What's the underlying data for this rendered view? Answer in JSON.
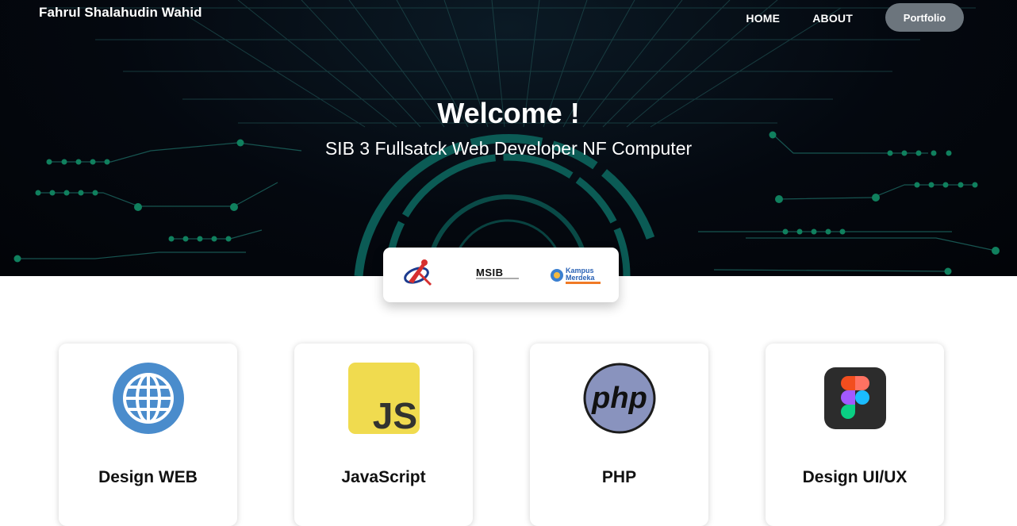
{
  "header": {
    "brand": "Fahrul Shalahudin Wahid",
    "nav": {
      "home": "HOME",
      "about": "ABOUT",
      "portfolio": "Portfolio"
    }
  },
  "hero": {
    "title": "Welcome !",
    "subtitle": "SIB 3 Fullsatck Web Developer NF Computer"
  },
  "partners": {
    "logos": [
      "nf-computer-logo",
      "msib-logo",
      "kampus-merdeka-logo"
    ],
    "msib_text": "MSIB",
    "kampus_text_1": "Kampus",
    "kampus_text_2": "Merdeka"
  },
  "skills": [
    {
      "title": "Design WEB",
      "icon": "globe-icon"
    },
    {
      "title": "JavaScript",
      "icon": "javascript-icon",
      "icon_text": "JS"
    },
    {
      "title": "PHP",
      "icon": "php-icon",
      "icon_text": "php"
    },
    {
      "title": "Design UI/UX",
      "icon": "figma-icon"
    }
  ],
  "colors": {
    "hero_bg": "#04080f",
    "accent_teal": "#0e6b62",
    "nav_button": "#6c757d",
    "globe_blue": "#4a8ccc",
    "js_yellow": "#f0db4f",
    "php_purple": "#8993be"
  }
}
